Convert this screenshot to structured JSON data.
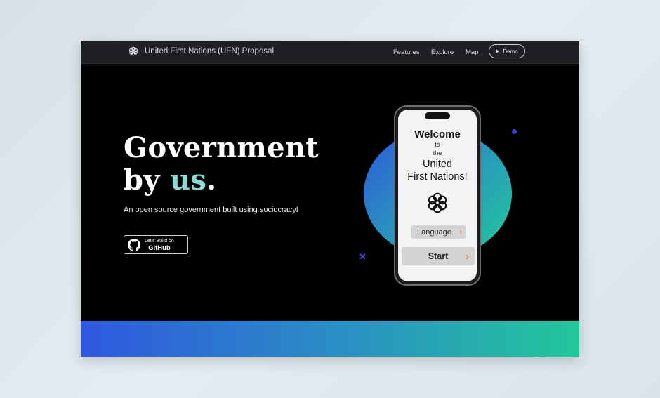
{
  "nav": {
    "brand": "United First Nations (UFN) Proposal",
    "links": [
      "Features",
      "Explore",
      "Map"
    ],
    "demo_label": "Demo"
  },
  "hero": {
    "headline_line1": "Government",
    "headline_by": "by",
    "headline_us": "us",
    "headline_period": ".",
    "subtitle": "An open source government built using sociocracy!",
    "github_small": "Let's Build on",
    "github_big": "GitHub"
  },
  "phone": {
    "welcome": "Welcome",
    "to": "to",
    "the": "the",
    "united": "United",
    "first_nations": "First Nations!",
    "language_label": "Language",
    "start_label": "Start"
  },
  "colors": {
    "accent": "#8ed8d6",
    "chevron": "#f08a25",
    "gradient_start": "#2f58e0",
    "gradient_end": "#22c79b"
  },
  "icons": [
    "flower-logo-icon",
    "play-icon",
    "github-icon",
    "chevron-right-icon",
    "cross-icon"
  ]
}
